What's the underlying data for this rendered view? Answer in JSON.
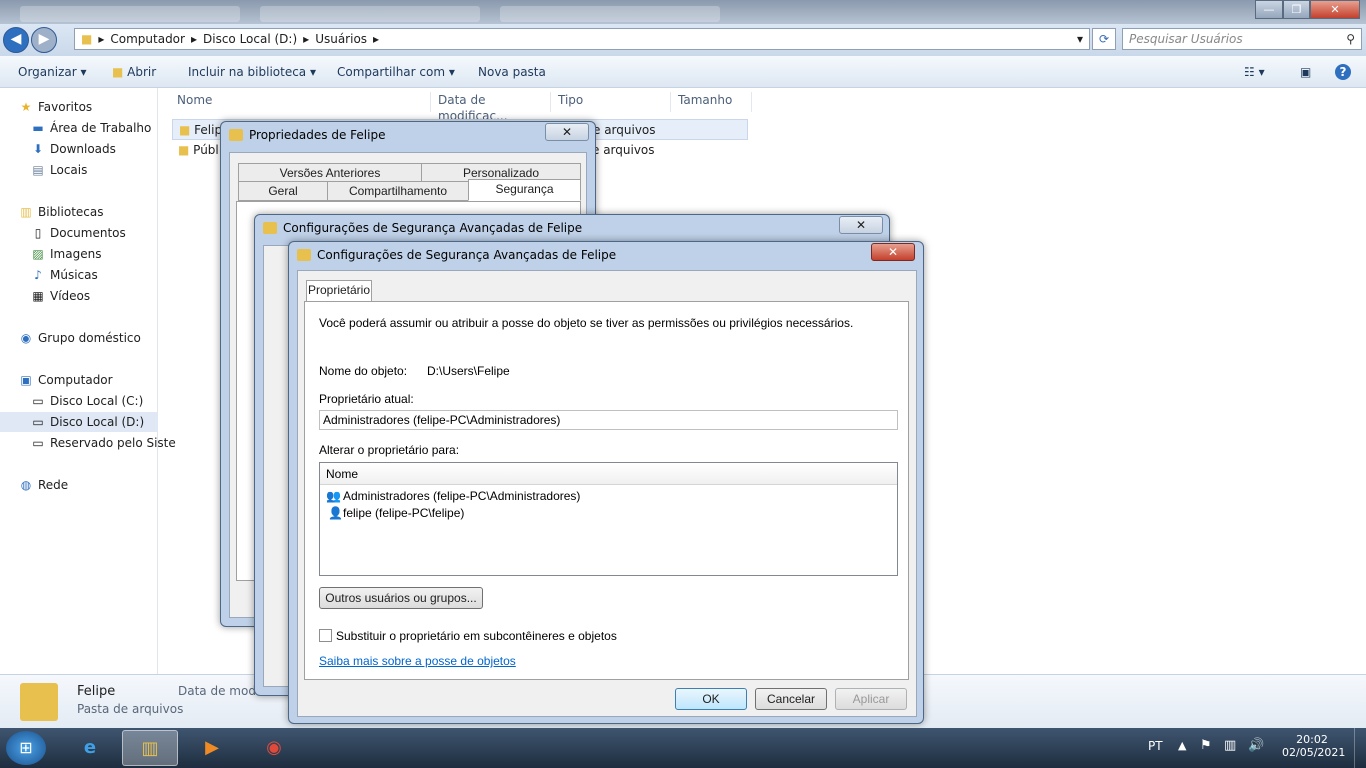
{
  "explorer": {
    "breadcrumb": [
      "Computador",
      "Disco Local (D:)",
      "Usuários"
    ],
    "search_placeholder": "Pesquisar Usuários",
    "toolbar": {
      "organize": "Organizar",
      "open": "Abrir",
      "include": "Incluir na biblioteca",
      "share": "Compartilhar com",
      "new_folder": "Nova pasta"
    },
    "nav": {
      "favorites": "Favoritos",
      "desktop": "Área de Trabalho",
      "downloads": "Downloads",
      "places": "Locais",
      "libraries": "Bibliotecas",
      "documents": "Documentos",
      "images": "Imagens",
      "music": "Músicas",
      "videos": "Vídeos",
      "homegroup": "Grupo doméstico",
      "computer": "Computador",
      "disk_c": "Disco Local (C:)",
      "disk_d": "Disco Local (D:)",
      "reserved": "Reservado pelo Siste",
      "network": "Rede"
    },
    "columns": {
      "name": "Nome",
      "date": "Data de modificaç...",
      "type": "Tipo",
      "size": "Tamanho"
    },
    "files": [
      {
        "name": "Felipe",
        "type": "e arquivos"
      },
      {
        "name": "Públ",
        "type": "e arquivos"
      }
    ],
    "details": {
      "name": "Felipe",
      "kind": "Pasta de arquivos",
      "date_label": "Data de modif"
    }
  },
  "props_dialog": {
    "title": "Propriedades de Felipe",
    "tabs_row1": [
      "Versões Anteriores",
      "Personalizado"
    ],
    "tabs_row2": [
      "Geral",
      "Compartilhamento",
      "Segurança"
    ]
  },
  "adv_back": {
    "title": "Configurações de Segurança Avançadas de Felipe"
  },
  "adv_front": {
    "title": "Configurações de Segurança Avançadas de Felipe",
    "tab": "Proprietário",
    "intro": "Você poderá assumir ou atribuir a posse do objeto se tiver as permissões ou privilégios necessários.",
    "object_name_label": "Nome do objeto:",
    "object_name_value": "D:\\Users\\Felipe",
    "current_owner_label": "Proprietário atual:",
    "current_owner_value": "Administradores (felipe-PC\\Administradores)",
    "change_owner_label": "Alterar o proprietário para:",
    "list_header": "Nome",
    "owners": [
      "Administradores (felipe-PC\\Administradores)",
      "felipe (felipe-PC\\felipe)"
    ],
    "other_users_button": "Outros usuários ou grupos...",
    "replace_checkbox": "Substituir o proprietário em subcontêineres e objetos",
    "learn_more": "Saiba mais sobre a posse de objetos",
    "ok": "OK",
    "cancel": "Cancelar",
    "apply": "Aplicar"
  },
  "taskbar": {
    "lang": "PT",
    "time": "20:02",
    "date": "02/05/2021"
  }
}
